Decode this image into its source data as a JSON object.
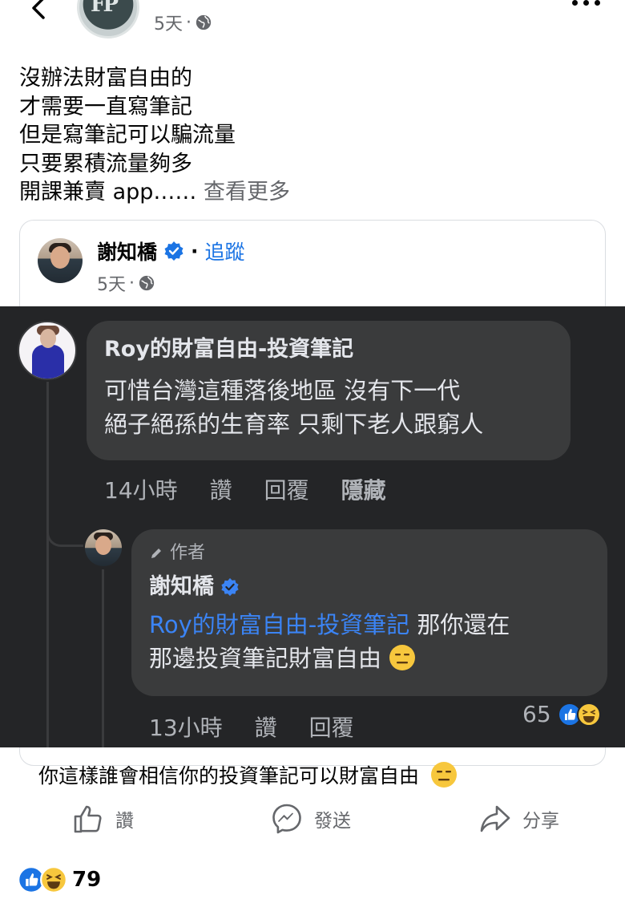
{
  "header": {
    "page_name_partial": "…",
    "post_time": "5天",
    "meta_separator": "·"
  },
  "post": {
    "lines": [
      "沒辦法財富自由的",
      "才需要一直寫筆記",
      "但是寫筆記可以騙流量",
      "只要累積流量夠多",
      "開課兼賣 app……"
    ],
    "see_more": "查看更多"
  },
  "shared": {
    "name": "謝知橋",
    "separator": "·",
    "follow": "追蹤",
    "time": "5天",
    "meta_separator": "·"
  },
  "comment1": {
    "author": "Roy的財富自由-投資筆記",
    "line1": "可惜台灣這種落後地區 沒有下一代",
    "line2": "絕子絕孫的生育率 只剩下老人跟窮人",
    "time": "14小時",
    "like": "讚",
    "reply": "回覆",
    "hide": "隱藏"
  },
  "comment2": {
    "author_badge": "作者",
    "author": "謝知橋",
    "mention": "Roy的財富自由-投資筆記",
    "text_after_mention": " 那你還在",
    "line2": "那邊投資筆記財富自由",
    "time": "13小時",
    "like": "讚",
    "reply": "回覆",
    "reaction_count": "65"
  },
  "caption": "你這樣誰會相信你的投資筆記可以財富自由",
  "actions": {
    "like": "讚",
    "send": "發送",
    "share": "分享"
  },
  "reactions": {
    "count": "79"
  },
  "colors": {
    "link": "#1b74e4",
    "mention": "#3b84f5",
    "dark_bg": "#242527",
    "bubble": "#3a3b3c"
  }
}
